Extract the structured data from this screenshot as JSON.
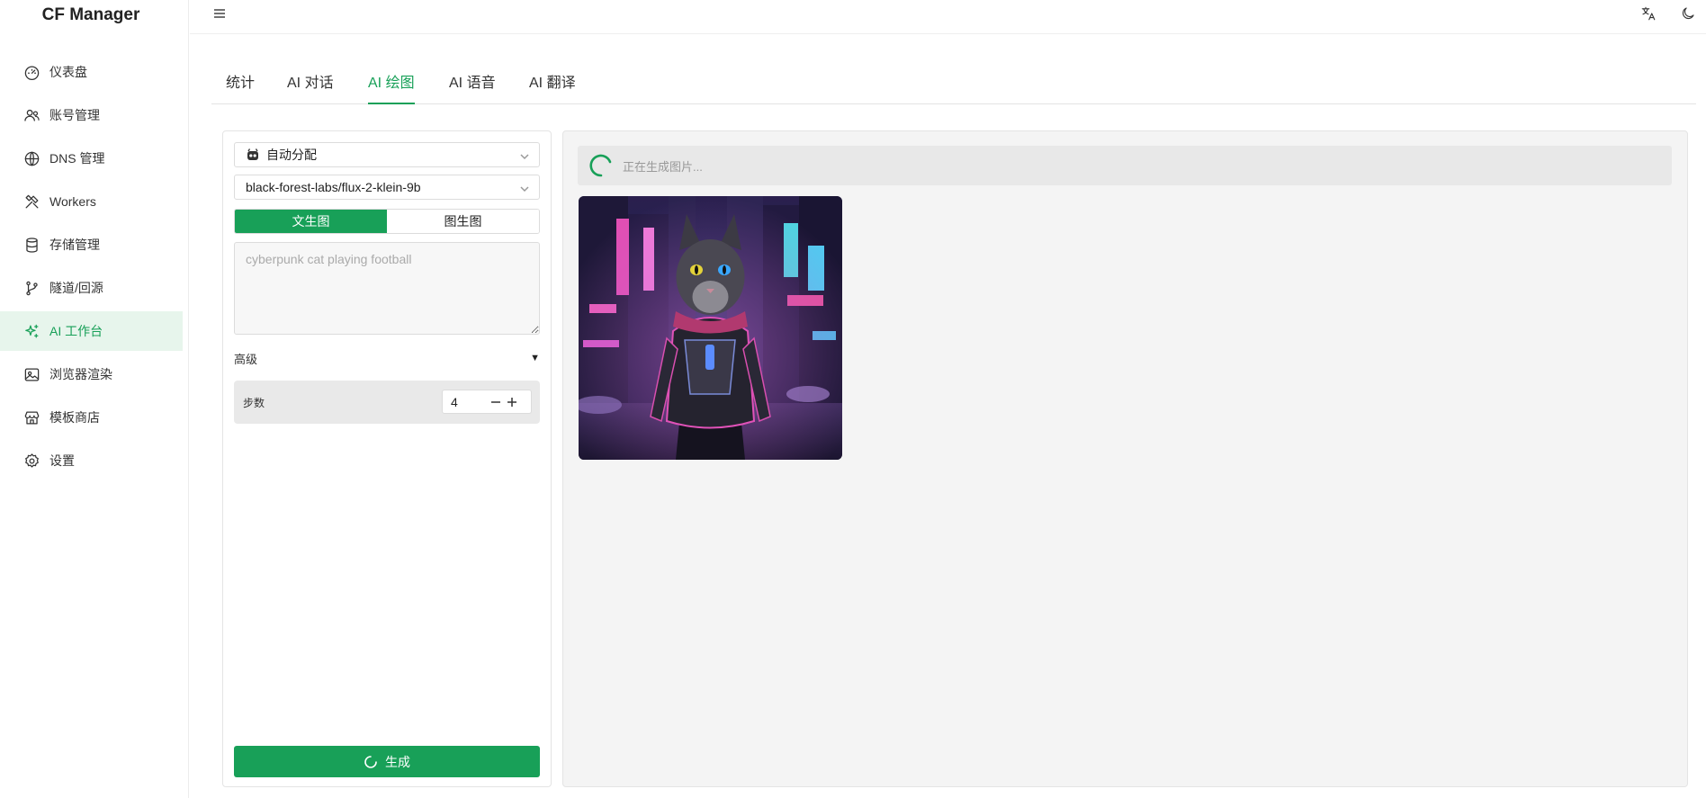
{
  "app": {
    "title": "CF Manager"
  },
  "sidebar": {
    "items": [
      {
        "label": "仪表盘",
        "icon": "dashboard-icon",
        "active": false
      },
      {
        "label": "账号管理",
        "icon": "users-icon",
        "active": false
      },
      {
        "label": "DNS 管理",
        "icon": "globe-icon",
        "active": false
      },
      {
        "label": "Workers",
        "icon": "tools-icon",
        "active": false
      },
      {
        "label": "存储管理",
        "icon": "database-icon",
        "active": false
      },
      {
        "label": "隧道/回源",
        "icon": "git-branch-icon",
        "active": false
      },
      {
        "label": "AI 工作台",
        "icon": "sparkles-icon",
        "active": true
      },
      {
        "label": "浏览器渲染",
        "icon": "image-icon",
        "active": false
      },
      {
        "label": "模板商店",
        "icon": "store-icon",
        "active": false
      },
      {
        "label": "设置",
        "icon": "gear-icon",
        "active": false
      }
    ]
  },
  "header": {
    "translate_icon": "translate-icon",
    "theme_icon": "moon-icon",
    "menu_icon": "menu-icon"
  },
  "tabs": [
    {
      "label": "统计",
      "active": false
    },
    {
      "label": "AI 对话",
      "active": false
    },
    {
      "label": "AI 绘图",
      "active": true
    },
    {
      "label": "AI 语音",
      "active": false
    },
    {
      "label": "AI 翻译",
      "active": false
    }
  ],
  "form": {
    "account_select": "自动分配",
    "model_select": "black-forest-labs/flux-2-klein-9b",
    "mode_text2img": "文生图",
    "mode_img2img": "图生图",
    "prompt_placeholder": "cyberpunk cat playing football",
    "advanced_label": "高级",
    "steps_label": "步数",
    "steps_value": "4",
    "generate_label": "生成"
  },
  "result": {
    "status_text": "正在生成图片..."
  },
  "colors": {
    "accent": "#18a058",
    "accent_bg": "#e7f5ec"
  }
}
